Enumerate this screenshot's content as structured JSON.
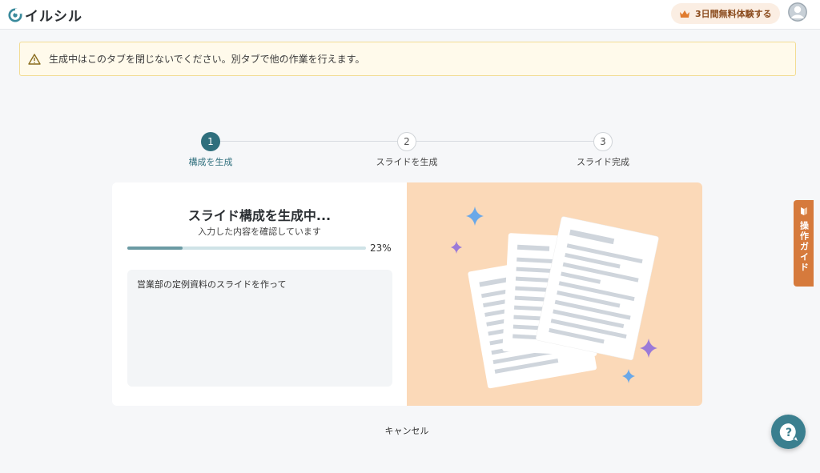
{
  "header": {
    "logo_text": "イルシル",
    "trial_label": "3日間無料体験する"
  },
  "warning": {
    "text": "生成中はこのタブを閉じないでください。別タブで他の作業を行えます。"
  },
  "steps": [
    {
      "number": "1",
      "label": "構成を生成",
      "state": "active"
    },
    {
      "number": "2",
      "label": "スライドを生成",
      "state": "pending"
    },
    {
      "number": "3",
      "label": "スライド完成",
      "state": "pending"
    }
  ],
  "generation": {
    "title": "スライド構成を生成中...",
    "subtitle": "入力した内容を確認しています",
    "progress": 0.23,
    "progress_label": "23%",
    "prompt": "営業部の定例資料のスライドを作って"
  },
  "cancel_label": "キャンセル",
  "guide_tab_label": "操作ガイド",
  "colors": {
    "accent": "#2f6f7d",
    "warning_bg": "#fffaeb",
    "illustration_bg": "#fbd9b8",
    "guide_tab": "#d67a3c"
  },
  "icons": [
    "logo-icon",
    "crown-icon",
    "user-avatar-icon",
    "warning-icon",
    "beginner-mark-icon",
    "help-question-icon"
  ]
}
